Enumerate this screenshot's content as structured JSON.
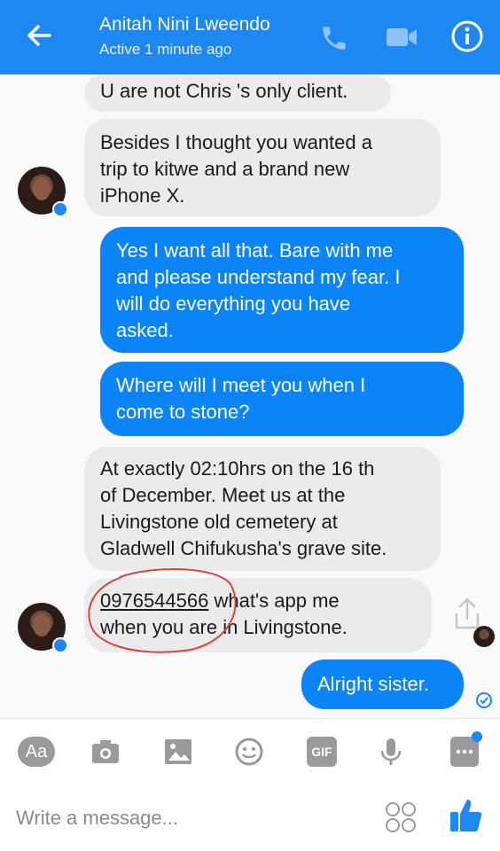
{
  "header": {
    "contact_name": "Anitah Nini Lweendo",
    "status": "Active 1 minute ago"
  },
  "messages": [
    {
      "direction": "incoming",
      "lines": [
        "U are not Chris 's only client."
      ]
    },
    {
      "direction": "incoming",
      "lines": [
        "Besides I thought you wanted a",
        "trip to kitwe and a brand new",
        "iPhone X."
      ]
    },
    {
      "direction": "outgoing",
      "lines": [
        "Yes I want all that. Bare with me",
        "and please understand my fear. I",
        "will do everything you have",
        "asked."
      ]
    },
    {
      "direction": "outgoing",
      "lines": [
        "Where will I meet you when I",
        "come to stone?"
      ]
    },
    {
      "direction": "incoming",
      "lines": [
        "At exactly 02:10hrs on the 16 th",
        "of December. Meet us at the",
        "Livingstone old cemetery at",
        "Gladwell Chifukusha's grave site."
      ]
    },
    {
      "direction": "incoming",
      "phone": "0976544566",
      "lines": [
        " what's app me",
        "when you are in Livingstone."
      ]
    },
    {
      "direction": "outgoing",
      "lines": [
        "Alright sister."
      ]
    }
  ],
  "toolbar": {
    "text_label": "Aa",
    "gif_label": "GIF"
  },
  "composer": {
    "placeholder": "Write a message..."
  },
  "colors": {
    "brand_blue": "#1e88f2",
    "outgoing_bubble": "#0a84f6",
    "incoming_bubble": "#ebebeb",
    "annotation_red": "#d9453b"
  },
  "icons": [
    "back-arrow-icon",
    "phone-icon",
    "video-icon",
    "info-icon",
    "share-icon",
    "delivered-check-icon",
    "text-format-icon",
    "camera-icon",
    "gallery-icon",
    "emoji-icon",
    "gif-icon",
    "microphone-icon",
    "more-icon",
    "stickers-icon",
    "like-thumb-icon"
  ]
}
